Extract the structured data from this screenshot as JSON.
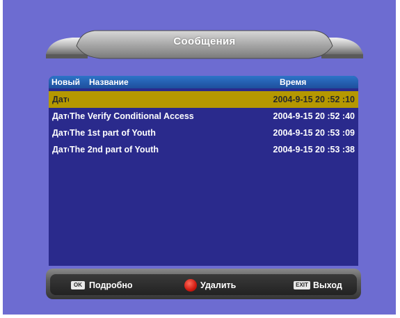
{
  "header": {
    "title": "Сообщения"
  },
  "columns": {
    "new": "Новый",
    "name": "Название",
    "time": "Время"
  },
  "messages": [
    {
      "new": "Дате",
      "name": "",
      "time": "2004-9-15 20 :52 :10",
      "selected": true
    },
    {
      "new": "Дате",
      "name": "The Verify Conditional Access",
      "time": "2004-9-15 20 :52 :40",
      "selected": false
    },
    {
      "new": "Дате",
      "name": "The 1st part of Youth",
      "time": "2004-9-15 20 :53 :09",
      "selected": false
    },
    {
      "new": "Дате",
      "name": "The 2nd part of Youth",
      "time": "2004-9-15 20 :53 :38",
      "selected": false
    }
  ],
  "footer": {
    "ok_key": "OK",
    "ok_label": "Подробно",
    "delete_label": "Удалить",
    "exit_key": "EXIT",
    "exit_label": "Выход"
  },
  "colors": {
    "background": "#6d6cd1",
    "list_panel": "#2a2a8c",
    "selection": "#b59800",
    "header_bar": "#2d74c8"
  },
  "icons": {
    "delete": "red-circle-icon"
  }
}
